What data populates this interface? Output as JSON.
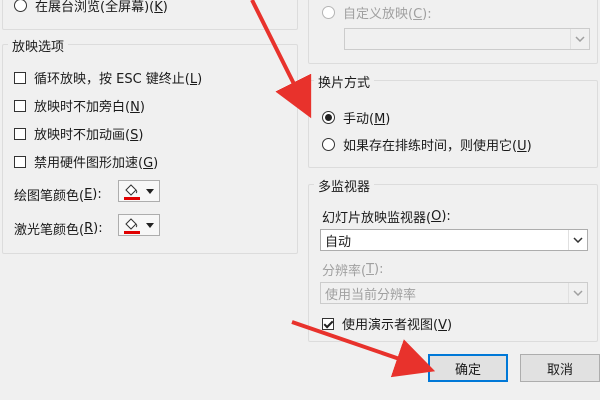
{
  "top_left": {
    "radio_label": "在展台浏览(全屏幕)(",
    "radio_key": "K",
    "radio_tail": ")"
  },
  "slide_options": {
    "title": "放映选项",
    "checkboxes": [
      {
        "label": "循环放映，按 ESC 键终止(",
        "key": "L",
        "tail": ")",
        "checked": false
      },
      {
        "label": "放映时不加旁白(",
        "key": "N",
        "tail": ")",
        "checked": false
      },
      {
        "label": "放映时不加动画(",
        "key": "S",
        "tail": ")",
        "checked": false
      },
      {
        "label": "禁用硬件图形加速(",
        "key": "G",
        "tail": ")",
        "checked": false
      }
    ],
    "pen_color": {
      "label": "绘图笔颜色(",
      "key": "E",
      "tail": "):",
      "color": "#e00000"
    },
    "laser_color": {
      "label": "激光笔颜色(",
      "key": "R",
      "tail": "):",
      "color": "#e00000"
    }
  },
  "custom_show": {
    "radio_label": "自定义放映(",
    "key": "C",
    "tail": "):",
    "value": ""
  },
  "advance": {
    "title": "换片方式",
    "options": [
      {
        "label": "手动(",
        "key": "M",
        "tail": ")",
        "selected": true
      },
      {
        "label": "如果存在排练时间，则使用它(",
        "key": "U",
        "tail": ")",
        "selected": false
      }
    ]
  },
  "monitors": {
    "title": "多监视器",
    "monitor_label": "幻灯片放映监视器(",
    "monitor_key": "O",
    "monitor_tail": "):",
    "monitor_value": "自动",
    "resolution_label": "分辨率(",
    "resolution_key": "T",
    "resolution_tail": "):",
    "resolution_value": "使用当前分辨率",
    "presenter_label": "使用演示者视图(",
    "presenter_key": "V",
    "presenter_tail": ")",
    "presenter_checked": true
  },
  "buttons": {
    "ok": "确定",
    "cancel": "取消"
  },
  "colors": {
    "accent": "#0078d7",
    "arrow_red": "#e8322c"
  }
}
